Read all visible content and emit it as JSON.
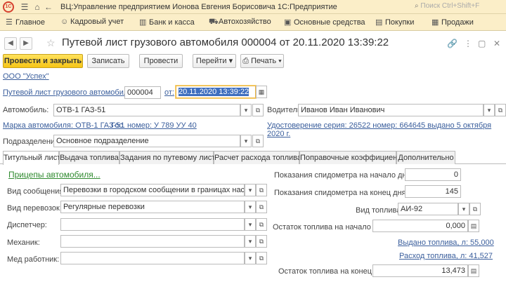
{
  "titlebar": {
    "title": "ВЦ:Управление предприятием Ионова Евгения Борисовича 1С:Предприятие",
    "search_placeholder": "Поиск Ctrl+Shift+F"
  },
  "sections": [
    "Главное",
    "Кадровый учет",
    "Банк и касса",
    "Автохозяйство",
    "Основные средства",
    "Покупки",
    "Продажи"
  ],
  "document": {
    "title": "Путевой лист грузового автомобиля 000004 от 20.11.2020 13:39:22"
  },
  "toolbar": {
    "post_close": "Провести и закрыть",
    "save": "Записать",
    "post": "Провести",
    "goto": "Перейти",
    "print": "Печать"
  },
  "form": {
    "org_link": "ООО \"Успех\"",
    "doc_number_label": "Путевой лист грузового автомобиля №:",
    "doc_number": "000004",
    "date_label": "от:",
    "date_value": "20.11.2020 13:39:22",
    "vehicle_label": "Автомобиль:",
    "vehicle_value": "ОТВ-1 ГАЗ-51",
    "driver_label": "Водитель:",
    "driver_value": "Иванов Иван Иванович",
    "brand_link": "Марка автомобиля: ОТВ-1 ГАЗ-51",
    "plate_link": "Гос. номер: У 789 УУ 40",
    "license_link_1": "Удостоверение серия: 26522 номер: 664645 выдано 5 октября",
    "license_link_2": "2020 г.",
    "division_label": "Подразделение:",
    "division_value": "Основное подразделение"
  },
  "tabs": [
    "Титульный лист",
    "Выдача топлива",
    "Задания по путевому листу",
    "Расчет расхода топлива",
    "Поправочные коэффициенты",
    "Дополнительно"
  ],
  "title_page": {
    "trailers_link": "Прицепы автомобиля...",
    "comm_type_label": "Вид сообщения:",
    "comm_type_value": "Перевозки в городском сообщении в границах населенных",
    "transport_label": "Вид перевозок:",
    "transport_value": "Регулярные перевозки",
    "dispatcher_label": "Диспетчер:",
    "mechanic_label": "Механик:",
    "medic_label": "Мед работник:",
    "odo_start_label": "Показания спидометра на начало дня, км:",
    "odo_start_value": "0",
    "odo_end_label": "Показания спидометра на конец дня, км:",
    "odo_end_value": "145",
    "fuel_type_label": "Вид топлива:",
    "fuel_type_value": "АИ-92",
    "fuel_start_label": "Остаток топлива на начало дня:",
    "fuel_start_value": "0,000",
    "fuel_issued_link": "Выдано топлива, л: 55,000",
    "fuel_used_link": "Расход топлива, л: 41,527",
    "fuel_end_label": "Остаток топлива на конец дня:",
    "fuel_end_value": "13,473"
  }
}
